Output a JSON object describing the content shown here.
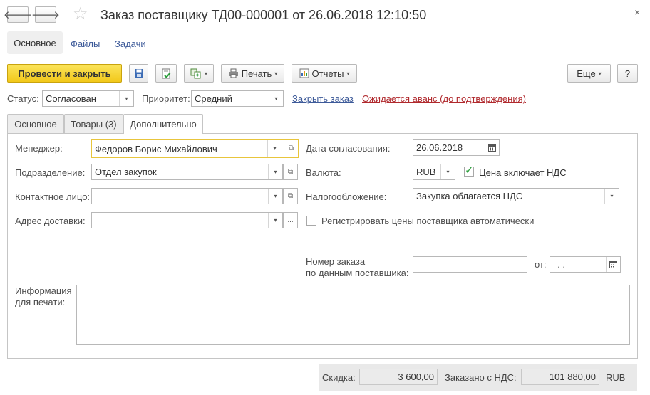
{
  "window": {
    "title": "Заказ поставщику ТД00-000001 от 26.06.2018 12:10:50",
    "back_glyph": "🡐",
    "forward_glyph": "🡒",
    "star_glyph": "☆",
    "close_glyph": "×"
  },
  "subnav": {
    "active": "Основное",
    "links": [
      "Файлы",
      "Задачи"
    ]
  },
  "toolbar": {
    "post_close": "Провести и закрыть",
    "print": "Печать",
    "reports": "Отчеты",
    "more": "Еще",
    "help": "?"
  },
  "status_row": {
    "status_label": "Статус:",
    "status_value": "Согласован",
    "priority_label": "Приоритет:",
    "priority_value": "Средний",
    "close_order_link": "Закрыть заказ",
    "advance_link": "Ожидается аванс (до подтверждения)"
  },
  "tabs": [
    "Основное",
    "Товары (3)",
    "Дополнительно"
  ],
  "form": {
    "manager_label": "Менеджер:",
    "manager_value": "Федоров Борис Михайлович",
    "department_label": "Подразделение:",
    "department_value": "Отдел закупок",
    "contact_label": "Контактное лицо:",
    "contact_value": "",
    "address_label": "Адрес доставки:",
    "address_value": "",
    "approval_date_label": "Дата согласования:",
    "approval_date_value": "26.06.2018",
    "currency_label": "Валюта:",
    "currency_value": "RUB",
    "price_incl_vat_label": "Цена включает НДС",
    "price_incl_vat_checked": true,
    "taxation_label": "Налогообложение:",
    "taxation_value": "Закупка облагается НДС",
    "register_prices_label": "Регистрировать цены поставщика автоматически",
    "register_prices_checked": false,
    "supplier_order_label_1": "Номер заказа",
    "supplier_order_label_2": "по данным поставщика:",
    "supplier_order_value": "",
    "from_label": "от:",
    "from_value": " .  . ",
    "print_info_label_1": "Информация",
    "print_info_label_2": "для печати:",
    "print_info_value": ""
  },
  "footer": {
    "discount_label": "Скидка:",
    "discount_value": "3 600,00",
    "ordered_vat_label": "Заказано с НДС:",
    "ordered_vat_value": "101 880,00",
    "currency": "RUB"
  },
  "icons": {
    "dropdown": "▾",
    "open": "⧉",
    "calendar": "calendar-icon",
    "ellipsis": "..."
  },
  "colors": {
    "primary_button": "#f2c81a",
    "link": "#3d5a99",
    "warning_link": "#b0292d",
    "check": "#2a9d3a",
    "focus_border": "#e8c53c"
  }
}
